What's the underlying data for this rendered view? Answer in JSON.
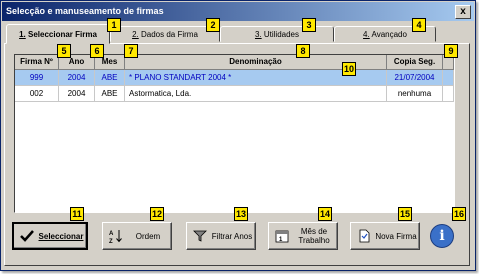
{
  "window": {
    "title": "Selecção e manuseamento de firmas",
    "close_glyph": "x"
  },
  "tabs": [
    {
      "num": "1.",
      "label": "Seleccionar Firma"
    },
    {
      "num": "2.",
      "label": "Dados da Firma"
    },
    {
      "num": "3.",
      "label": "Utilidades"
    },
    {
      "num": "4.",
      "label": "Avançado"
    }
  ],
  "grid": {
    "columns": [
      "Firma Nº",
      "Ano",
      "Mes",
      "Denominação",
      "Copia Seg."
    ],
    "rows": [
      {
        "firma": "999",
        "ano": "2004",
        "mes": "ABE",
        "denominacao": "* PLANO STANDART 2004 *",
        "copia": "21/07/2004"
      },
      {
        "firma": "002",
        "ano": "2004",
        "mes": "ABE",
        "denominacao": "Astormatica, Lda.",
        "copia": "nenhuma"
      }
    ]
  },
  "buttons": {
    "seleccionar": {
      "label": "Seleccionar",
      "icon": "checkmark-icon"
    },
    "ordem": {
      "label": "Ordem",
      "icon": "sort-az-icon"
    },
    "filtrar": {
      "label": "Filtrar Anos",
      "icon": "filter-funnel-icon"
    },
    "mes": {
      "label": "Mês de Trabalho",
      "icon": "calendar-icon"
    },
    "nova": {
      "label": "Nova Firma",
      "icon": "new-document-icon"
    },
    "help": {
      "label": "i",
      "icon": "info-icon"
    }
  },
  "badges": [
    "1",
    "2",
    "3",
    "4",
    "5",
    "6",
    "7",
    "8",
    "9",
    "10",
    "11",
    "12",
    "13",
    "14",
    "15",
    "16"
  ],
  "colors": {
    "badge": "#ffe800",
    "selected_row": "#a6caf0",
    "titlebar_start": "#0a246a",
    "titlebar_end": "#a6caf0"
  }
}
